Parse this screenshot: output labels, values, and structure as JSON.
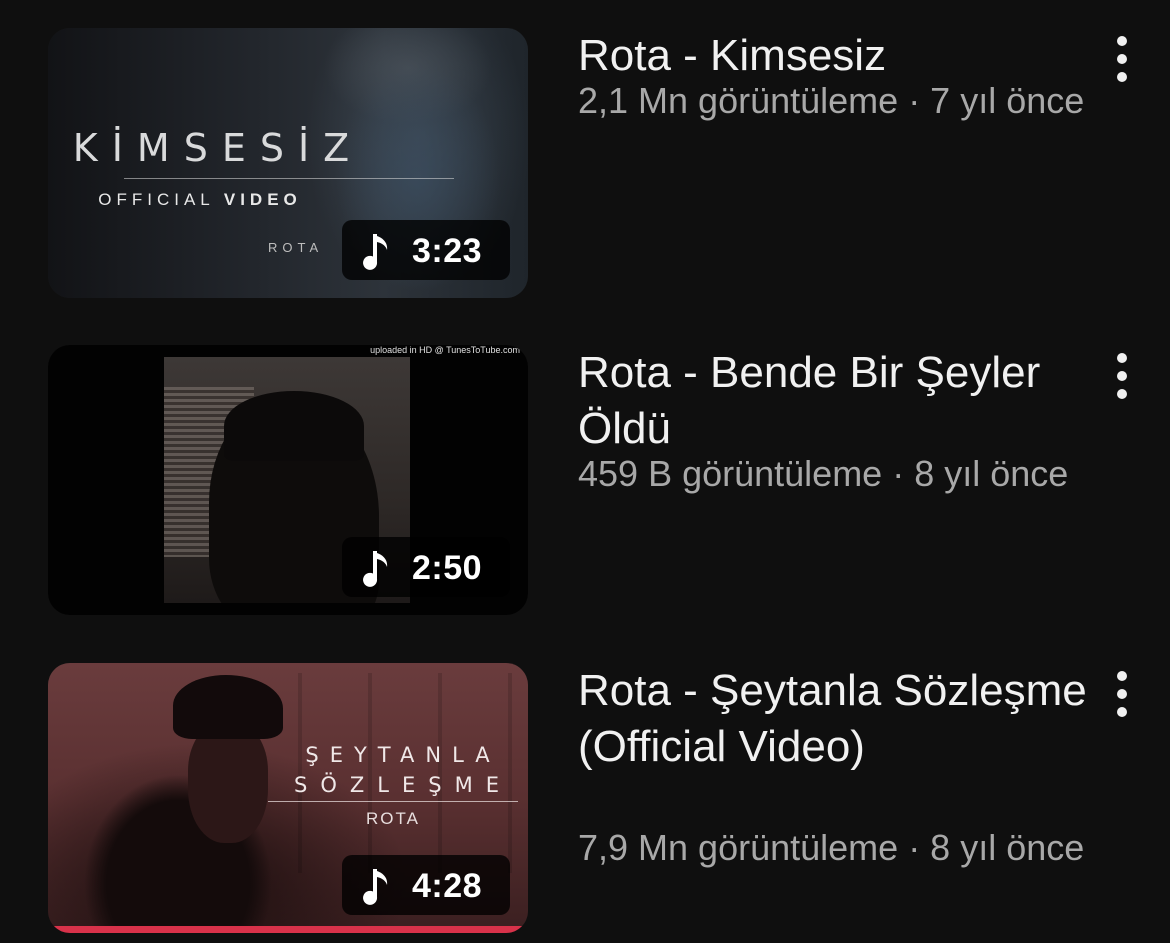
{
  "videos": [
    {
      "title": "Rota - Kimsesiz",
      "views": "2,1 Mn görüntüleme",
      "age": "7 yıl önce",
      "meta": "2,1 Mn görüntüleme · 7 yıl önce",
      "duration": "3:23",
      "thumbnail": {
        "title": "KİMSESİZ",
        "subtitle_plain": "OFFICIAL",
        "subtitle_bold": "VIDEO",
        "artist": "ROTA"
      }
    },
    {
      "title": "Rota - Bende Bir Şeyler Öldü",
      "views": "459 B görüntüleme",
      "age": "8 yıl önce",
      "meta": "459 B görüntüleme · 8 yıl önce",
      "duration": "2:50",
      "thumbnail": {
        "watermark": "uploaded in HD @ TunesToTube.com"
      }
    },
    {
      "title": "Rota - Şeytanla Sözleşme (Official Video)",
      "views": "7,9 Mn görüntüleme",
      "age": "8 yıl önce",
      "meta": "7,9 Mn görüntüleme · 8 yıl önce",
      "duration": "4:28",
      "watched_progress": 1.0,
      "thumbnail": {
        "title_line1": "ŞEYTANLA",
        "title_line2": "SÖZLEŞME",
        "artist": "ROTA"
      }
    }
  ],
  "icons": {
    "badge": "music-note-icon",
    "menu": "more-vertical-icon"
  },
  "colors": {
    "background": "#0f0f0f",
    "progress": "#d8324a"
  }
}
